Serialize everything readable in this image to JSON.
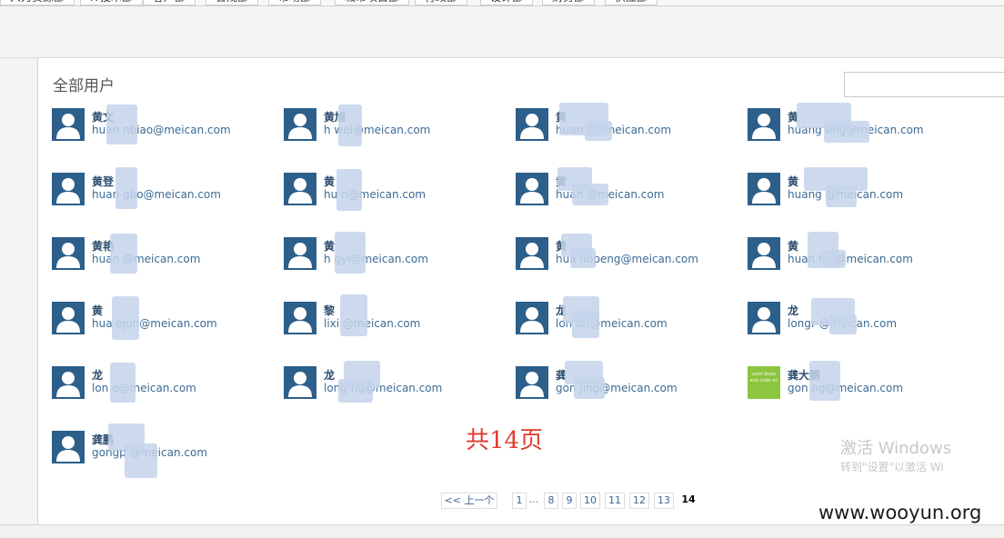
{
  "top_tabs": [
    {
      "label": "人力资源部"
    },
    {
      "label": "IT技术部"
    },
    {
      "label": "客户部"
    },
    {
      "label": "合规部"
    },
    {
      "label": "市场部"
    },
    {
      "label": "城市项目部"
    },
    {
      "label": "行政部"
    },
    {
      "label": "设计部"
    },
    {
      "label": "财务部"
    },
    {
      "label": "供应部"
    }
  ],
  "section": {
    "title": "全部用户"
  },
  "search": {
    "placeholder": ""
  },
  "users": [
    {
      "name": "黄文",
      "email": "huan    nbiao@meican.com"
    },
    {
      "name": "黄旭",
      "email": "h      wei@meican.com"
    },
    {
      "name": "黄",
      "email": "huan      g@meican.com"
    },
    {
      "name": "黄",
      "email": "huang       eng@meican.com"
    },
    {
      "name": "黄登",
      "email": "huan     gbo@meican.com"
    },
    {
      "name": "黄",
      "email": "hu       n@meican.com"
    },
    {
      "name": "黄",
      "email": "huan      @meican.com"
    },
    {
      "name": "黄",
      "email": "huang      @meican.com"
    },
    {
      "name": "黄艳",
      "email": "huan      @meican.com"
    },
    {
      "name": "黄",
      "email": "h      gyi@meican.com"
    },
    {
      "name": "黄",
      "email": "hua    nopeng@meican.com"
    },
    {
      "name": "黄",
      "email": "huan      hui@meican.com"
    },
    {
      "name": "黄",
      "email": "hua    ejun@meican.com"
    },
    {
      "name": "黎",
      "email": "lixi     @meican.com"
    },
    {
      "name": "龙",
      "email": "lon    un@meican.com"
    },
    {
      "name": "龙",
      "email": "longr      @meican.com"
    },
    {
      "name": "龙",
      "email": "lon     o@meican.com"
    },
    {
      "name": "龙",
      "email": "long      ng@meican.com"
    },
    {
      "name": "龚",
      "email": "gon     jing@meican.com"
    },
    {
      "name": "龚大鹏",
      "email": "gon       ng@meican.com"
    },
    {
      "name": "龚鹏",
      "email": "gongp      @meican.com"
    }
  ],
  "custom_avatar_text": "calm down and code on",
  "page_total": "共14页",
  "pagination": {
    "prev": "<< 上一个",
    "ellipsis": "...",
    "pages": [
      "1",
      "8",
      "9",
      "10",
      "11",
      "12",
      "13"
    ],
    "current": "14"
  },
  "os_watermark": {
    "line1": "激活 Windows",
    "line2": "转到\"设置\"以激活 Wi"
  },
  "site_watermark": "www.wooyun.org",
  "colors": {
    "name_text": "#2b4d6e",
    "email_text": "#3b6a95",
    "avatar_bg": "#2c5f8a",
    "custom_avatar_bg": "#8cc63f",
    "page_total": "#e03b2f"
  }
}
